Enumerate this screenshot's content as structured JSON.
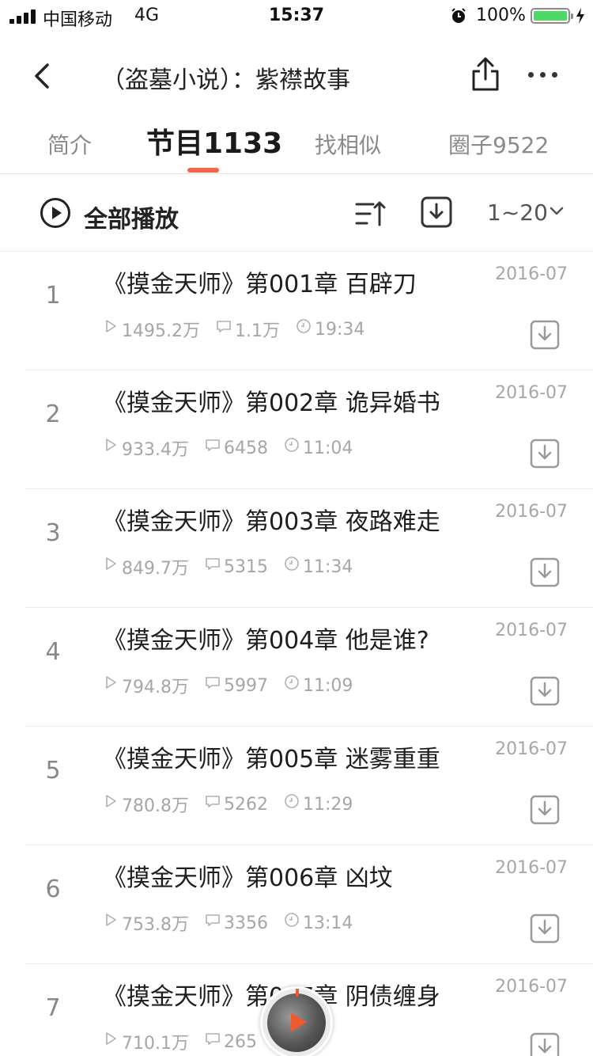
{
  "status_bar": {
    "carrier": "中国移动",
    "network": "4G",
    "time": "15:37",
    "battery_percent": "100%",
    "battery_level": 1.0,
    "battery_color": "#4cd964"
  },
  "nav": {
    "title": "（盗墓小说）：紫襟故事",
    "back_icon": "chevron-left-icon",
    "share_icon": "share-icon",
    "more_icon": "more-icon"
  },
  "tabs": [
    {
      "label": "简介",
      "active": false
    },
    {
      "label": "节目1133",
      "active": true
    },
    {
      "label": "找相似",
      "active": false
    },
    {
      "label": "圈子9522",
      "active": false
    }
  ],
  "accent_color": "#f86442",
  "toolbar": {
    "play_all_label": "全部播放",
    "range_label": "1~20"
  },
  "episodes": [
    {
      "index": "1",
      "title": "《摸金天师》第001章 百辟刀",
      "date": "2016-07",
      "plays": "1495.2万",
      "comments": "1.1万",
      "duration": "19:34"
    },
    {
      "index": "2",
      "title": "《摸金天师》第002章 诡异婚书",
      "date": "2016-07",
      "plays": "933.4万",
      "comments": "6458",
      "duration": "11:04"
    },
    {
      "index": "3",
      "title": "《摸金天师》第003章 夜路难走",
      "date": "2016-07",
      "plays": "849.7万",
      "comments": "5315",
      "duration": "11:34"
    },
    {
      "index": "4",
      "title": "《摸金天师》第004章 他是谁?",
      "date": "2016-07",
      "plays": "794.8万",
      "comments": "5997",
      "duration": "11:09"
    },
    {
      "index": "5",
      "title": "《摸金天师》第005章 迷雾重重",
      "date": "2016-07",
      "plays": "780.8万",
      "comments": "5262",
      "duration": "11:29"
    },
    {
      "index": "6",
      "title": "《摸金天师》第006章 凶坟",
      "date": "2016-07",
      "plays": "753.8万",
      "comments": "3356",
      "duration": "13:14"
    },
    {
      "index": "7",
      "title": "《摸金天师》第007章 阴债缠身",
      "date": "2016-07",
      "plays": "710.1万",
      "comments": "265",
      "duration": "06"
    }
  ]
}
